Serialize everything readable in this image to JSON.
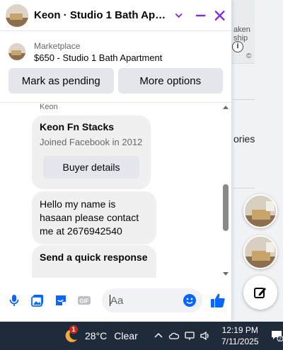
{
  "header": {
    "title": "Keon · Studio 1 Bath Apart...",
    "accent_color": "#8a2be2"
  },
  "listing": {
    "label": "Marketplace",
    "title": "$650 - Studio 1 Bath Apartment"
  },
  "actions": {
    "mark_pending": "Mark as pending",
    "more_options": "More options"
  },
  "thread": {
    "sender": "Keon",
    "profile_name": "Keon Fn Stacks",
    "profile_joined": "Joined Facebook in 2012",
    "buyer_details": "Buyer details",
    "message": "Hello my name is hasaan please contact me at 2676942540",
    "quick_response": "Send a quick response"
  },
  "composer": {
    "placeholder": "Aa",
    "gif_label": "GIF"
  },
  "background": {
    "map_text_1": "aken",
    "map_text_2": "ship",
    "map_text_3": "©",
    "map_info": "i",
    "stories_text": "ories"
  },
  "taskbar": {
    "weather_badge": "1",
    "temperature": "28°C",
    "condition": "Clear",
    "time": "12:19 PM",
    "date": "7/11/2025",
    "notification_count": "2"
  }
}
